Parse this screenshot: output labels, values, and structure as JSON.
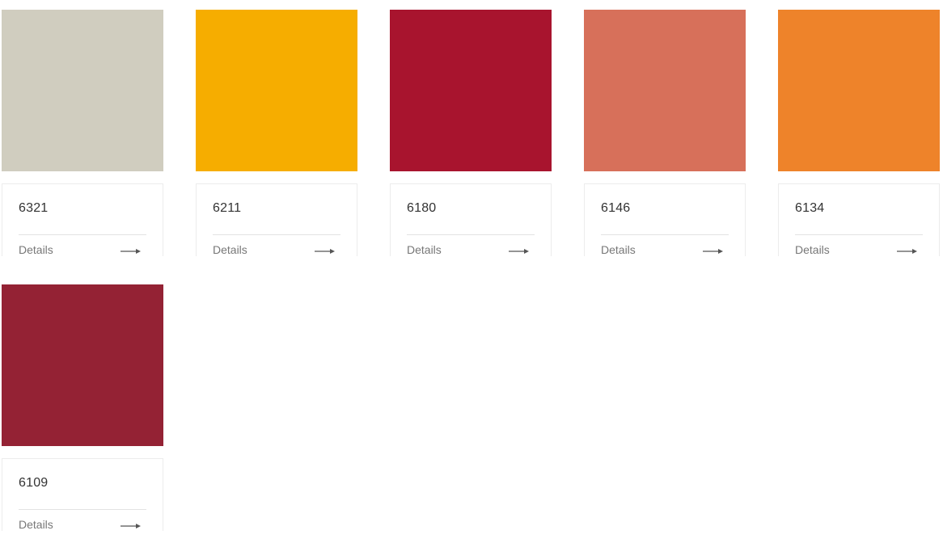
{
  "products": [
    {
      "code": "6321",
      "details_label": "Details",
      "color": "#d0cdbf",
      "arrow_icon": "long-right-arrow-icon"
    },
    {
      "code": "6211",
      "details_label": "Details",
      "color": "#f6ad00",
      "arrow_icon": "long-right-arrow-icon"
    },
    {
      "code": "6180",
      "details_label": "Details",
      "color": "#a8142e",
      "arrow_icon": "long-right-arrow-icon"
    },
    {
      "code": "6146",
      "details_label": "Details",
      "color": "#d7705a",
      "arrow_icon": "long-right-arrow-icon"
    },
    {
      "code": "6134",
      "details_label": "Details",
      "color": "#ee832a",
      "arrow_icon": "long-right-arrow-icon"
    },
    {
      "code": "6109",
      "details_label": "Details",
      "color": "#942234",
      "arrow_icon": "long-right-arrow-icon"
    }
  ]
}
